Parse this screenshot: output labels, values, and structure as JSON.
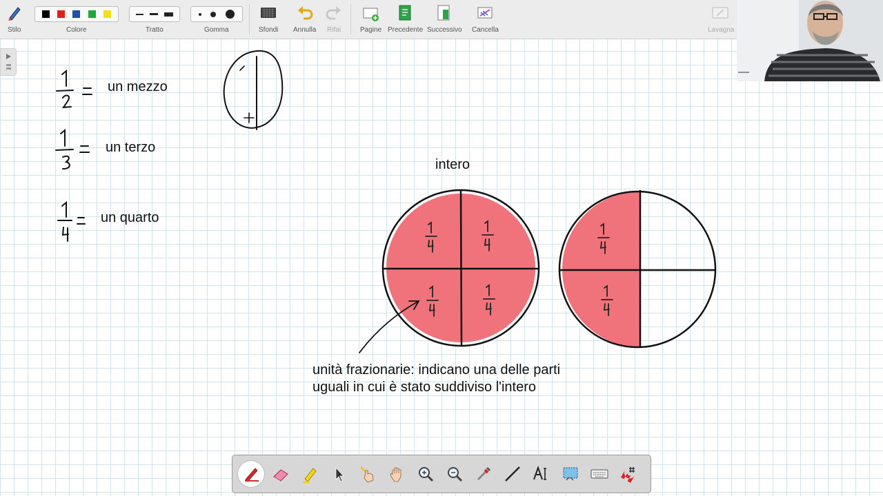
{
  "toolbar": {
    "stilo": "Stilo",
    "colore": "Colore",
    "tratto": "Tratto",
    "gomma": "Gomma",
    "sfondi": "Sfondi",
    "annulla": "Annulla",
    "rifai": "Rifai",
    "pagine": "Pagine",
    "precedente": "Precedente",
    "successivo": "Successivo",
    "cancella": "Cancella",
    "lavagna": "Lavagna",
    "colors": [
      "#000000",
      "#e0201c",
      "#1f4fa8",
      "#1fa83a",
      "#f2e01a"
    ]
  },
  "board": {
    "fraction_labels": [
      "un mezzo",
      "un terzo",
      "un quarto"
    ],
    "intero": "intero",
    "caption_line1": "unità frazionarie: indicano una delle parti",
    "caption_line2": "uguali in cui è stato suddiviso l'intero",
    "fill_color": "#f0737c"
  },
  "bottom_tools": [
    "pen-tool",
    "eraser-tool",
    "highlighter-tool",
    "pointer-tool",
    "laser-pointer-tool",
    "hand-pan-tool",
    "zoom-in-tool",
    "zoom-out-tool",
    "pipette-tool",
    "line-tool",
    "text-tool",
    "screenshot-tool",
    "keyboard-tool",
    "grid-magnet-tool"
  ]
}
